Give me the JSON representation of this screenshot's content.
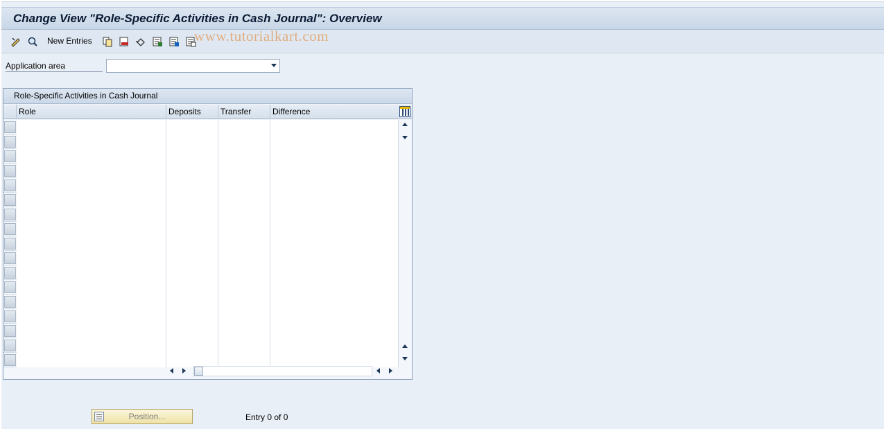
{
  "window": {
    "title": "Change View \"Role-Specific Activities in Cash Journal\": Overview"
  },
  "toolbar": {
    "new_entries_label": "New Entries",
    "icons": [
      "display-change-icon",
      "find-icon",
      "copy-icon",
      "delete-icon",
      "undo-change-icon",
      "select-all-icon",
      "select-block-icon",
      "deselect-all-icon"
    ]
  },
  "watermark": {
    "text": "www.tutorialkart.com"
  },
  "form": {
    "application_area_label": "Application area",
    "application_area_value": ""
  },
  "table": {
    "title": "Role-Specific Activities in Cash Journal",
    "columns": [
      {
        "key": "role",
        "label": "Role"
      },
      {
        "key": "deposits",
        "label": "Deposits"
      },
      {
        "key": "transfer",
        "label": "Transfer"
      },
      {
        "key": "difference",
        "label": "Difference"
      }
    ],
    "rows": []
  },
  "footer": {
    "position_button_label": "Position...",
    "entry_count_text": "Entry 0 of 0"
  },
  "colors": {
    "background": "#e9eff6",
    "title_text": "#0a1a33",
    "watermark": "#e0a36a",
    "position_button": "#efe3a6"
  }
}
